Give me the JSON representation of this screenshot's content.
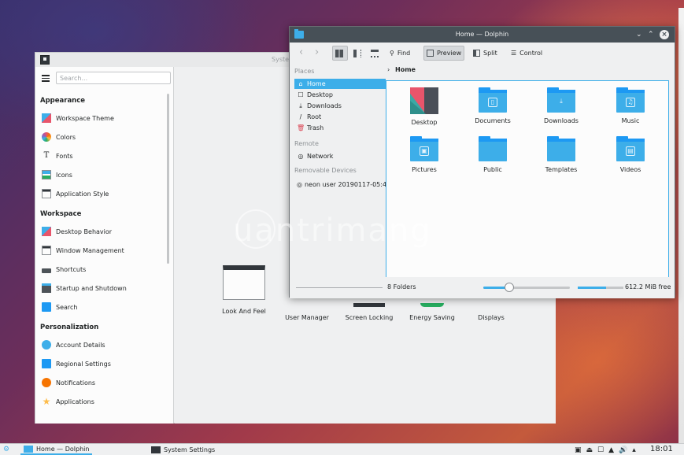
{
  "settings": {
    "title": "System Settings",
    "search_placeholder": "Search...",
    "sections": [
      {
        "label": "Appearance"
      },
      {
        "label": "Workspace"
      },
      {
        "label": "Personalization"
      }
    ],
    "items": [
      {
        "label": "Workspace Theme",
        "icon": "workspace-theme-icon"
      },
      {
        "label": "Colors",
        "icon": "colors-icon"
      },
      {
        "label": "Fonts",
        "icon": "fonts-icon"
      },
      {
        "label": "Icons",
        "icon": "icons-icon"
      },
      {
        "label": "Application Style",
        "icon": "application-style-icon"
      },
      {
        "label": "Desktop Behavior",
        "icon": "desktop-behavior-icon"
      },
      {
        "label": "Window Management",
        "icon": "window-management-icon"
      },
      {
        "label": "Shortcuts",
        "icon": "shortcuts-icon"
      },
      {
        "label": "Startup and Shutdown",
        "icon": "startup-shutdown-icon"
      },
      {
        "label": "Search",
        "icon": "search-icon"
      },
      {
        "label": "Account Details",
        "icon": "account-details-icon"
      },
      {
        "label": "Regional Settings",
        "icon": "regional-settings-icon"
      },
      {
        "label": "Notifications",
        "icon": "notifications-icon"
      },
      {
        "label": "Applications",
        "icon": "applications-icon"
      }
    ],
    "modules": [
      {
        "label": "Look And Feel"
      },
      {
        "label": "User Manager"
      },
      {
        "label": "Screen Locking"
      },
      {
        "label": "Energy Saving"
      },
      {
        "label": "Displays"
      }
    ]
  },
  "dolphin": {
    "title": "Home — Dolphin",
    "toolbar": {
      "find": "Find",
      "preview": "Preview",
      "split": "Split",
      "control": "Control"
    },
    "places": {
      "heading": "Places",
      "items": [
        {
          "label": "Home",
          "glyph": "⌂"
        },
        {
          "label": "Desktop",
          "glyph": "☐"
        },
        {
          "label": "Downloads",
          "glyph": "⤓"
        },
        {
          "label": "Root",
          "glyph": "/"
        },
        {
          "label": "Trash",
          "glyph": "🗑"
        }
      ],
      "remote_heading": "Remote",
      "network": {
        "label": "Network",
        "glyph": "◎"
      },
      "removable_heading": "Removable Devices",
      "device": {
        "label": "neon user 20190117-05:4",
        "glyph": "◎"
      }
    },
    "breadcrumb": "Home",
    "folders": [
      {
        "label": "Desktop"
      },
      {
        "label": "Documents",
        "emblem": "▯"
      },
      {
        "label": "Downloads",
        "emblem": "⤓"
      },
      {
        "label": "Music",
        "emblem": "♫"
      },
      {
        "label": "Pictures",
        "emblem": "▣"
      },
      {
        "label": "Public",
        "emblem": ""
      },
      {
        "label": "Templates",
        "emblem": ""
      },
      {
        "label": "Videos",
        "emblem": "▤"
      }
    ],
    "status": {
      "count": "8 Folders",
      "free": "612.2 MiB free",
      "zoom_fraction": 0.3,
      "space_used_fraction": 0.62
    }
  },
  "watermark": "uantrimang",
  "taskbar": {
    "tasks": [
      {
        "label": "Home — Dolphin"
      },
      {
        "label": "System Settings"
      }
    ],
    "clock": "18:01"
  },
  "colors": {
    "accent": "#3daee9",
    "titlebar": "#475057"
  }
}
